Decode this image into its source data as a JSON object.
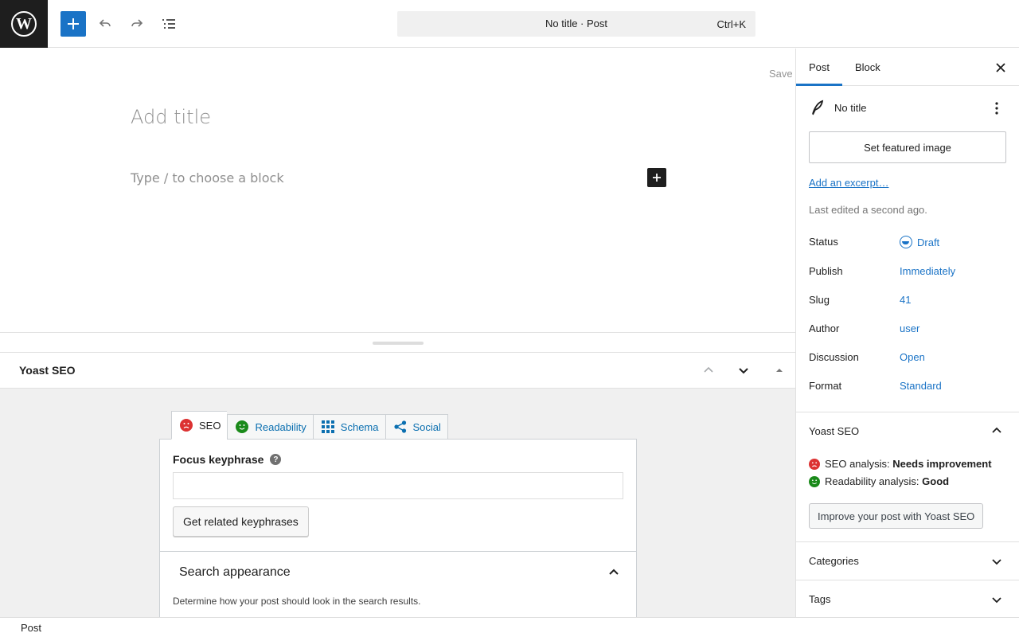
{
  "header": {
    "site_logo_name": "wordpress-logo",
    "document_title": "No title · Post",
    "shortcut": "Ctrl+K"
  },
  "editor": {
    "save_label": "Save",
    "title_placeholder": "Add title",
    "block_placeholder": "Type / to choose a block"
  },
  "metabox": {
    "title": "Yoast SEO",
    "tabs": [
      {
        "label": "SEO",
        "icon": "sad-face-icon"
      },
      {
        "label": "Readability",
        "icon": "smiley-face-icon"
      },
      {
        "label": "Schema",
        "icon": "grid-icon"
      },
      {
        "label": "Social",
        "icon": "share-icon"
      }
    ],
    "focus_keyphrase_label": "Focus keyphrase",
    "focus_keyphrase_value": "",
    "related_button": "Get related keyphrases",
    "search_appearance_title": "Search appearance",
    "search_appearance_desc": "Determine how your post should look in the search results."
  },
  "footer": {
    "breadcrumb": "Post"
  },
  "sidebar": {
    "tabs": [
      "Post",
      "Block"
    ],
    "active_tab": "Post",
    "post_title": "No title",
    "featured_image_button": "Set featured image",
    "excerpt_link": "Add an excerpt…",
    "last_edited": "Last edited a second ago.",
    "rows": [
      {
        "key": "Status",
        "value": "Draft"
      },
      {
        "key": "Publish",
        "value": "Immediately"
      },
      {
        "key": "Slug",
        "value": "41"
      },
      {
        "key": "Author",
        "value": "user"
      },
      {
        "key": "Discussion",
        "value": "Open"
      },
      {
        "key": "Format",
        "value": "Standard"
      }
    ],
    "yoast_panel": {
      "title": "Yoast SEO",
      "seo_label": "SEO analysis:",
      "seo_value": "Needs improvement",
      "readability_label": "Readability analysis:",
      "readability_value": "Good",
      "improve_button": "Improve your post with Yoast SEO"
    },
    "categories_title": "Categories",
    "tags_title": "Tags"
  },
  "colors": {
    "accent": "#1a73c6",
    "seo_bad": "#dc3232",
    "seo_good": "#1a8a1a"
  }
}
